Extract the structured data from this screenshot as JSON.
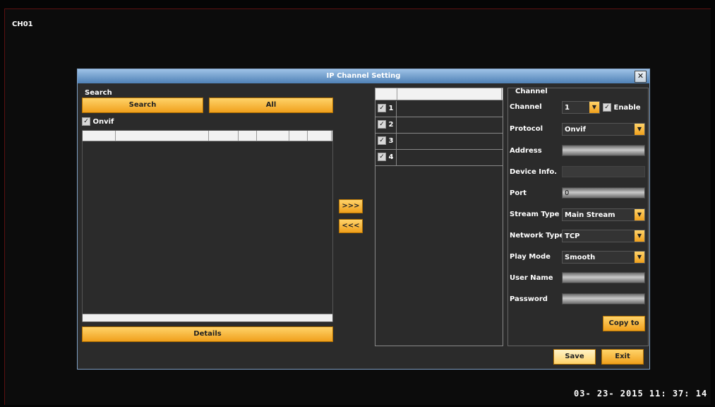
{
  "screen": {
    "channel_tag": "CH01",
    "datetime": "03- 23- 2015   11: 37: 14"
  },
  "dialog": {
    "title": "IP Channel Setting",
    "close_glyph": "✕",
    "left": {
      "search_label": "Search",
      "search_button": "Search",
      "all_button": "All",
      "onvif_checked": true,
      "onvif_label": "Onvif",
      "details_button": "Details"
    },
    "arrows": {
      "add": ">>>",
      "remove": "<<<"
    },
    "middle": {
      "rows": [
        {
          "num": "1",
          "checked": true
        },
        {
          "num": "2",
          "checked": true
        },
        {
          "num": "3",
          "checked": true
        },
        {
          "num": "4",
          "checked": true
        }
      ]
    },
    "right": {
      "section_label": "Channel",
      "channel_label": "Channel",
      "channel_value": "1",
      "enable_label": "Enable",
      "protocol_label": "Protocol",
      "protocol_value": "Onvif",
      "address_label": "Address",
      "address_value": "",
      "device_info_label": "Device Info.",
      "device_info_value": "",
      "port_label": "Port",
      "port_value": "0",
      "stream_type_label": "Stream Type",
      "stream_type_value": "Main Stream",
      "network_type_label": "Network Type",
      "network_type_value": "TCP",
      "play_mode_label": "Play Mode",
      "play_mode_value": "Smooth",
      "user_name_label": "User Name",
      "user_name_value": "",
      "password_label": "Password",
      "password_value": "",
      "copy_button": "Copy to"
    },
    "footer": {
      "save_button": "Save",
      "exit_button": "Exit"
    }
  },
  "colors": {
    "accent": "#f5b13a",
    "titlebar": "#6f9fd0",
    "panel": "#2b2b2b"
  },
  "icons": {
    "checkbox": "checked-box-icon",
    "dropdown": "dropdown-arrow-icon",
    "close": "close-icon"
  }
}
